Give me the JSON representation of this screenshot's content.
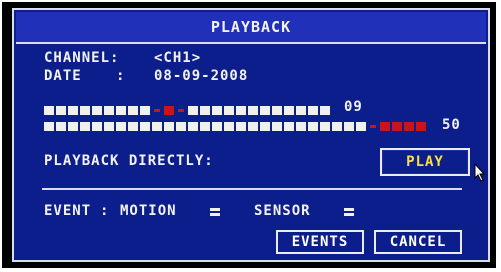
{
  "dialog": {
    "title": "PLAYBACK"
  },
  "channel": {
    "label": "CHANNEL:",
    "value": "<CH1>"
  },
  "date": {
    "label": "DATE",
    "separator": ":",
    "value": "08-09-2008"
  },
  "timeline": {
    "hour_value": "09",
    "minute_value": "50"
  },
  "playback_directly": {
    "label": "PLAYBACK DIRECTLY:",
    "button_label": "PLAY"
  },
  "event_filter": {
    "label": "EVENT",
    "separator": ":",
    "motion_label": "MOTION",
    "sensor_label": "SENSOR"
  },
  "buttons": {
    "events_label": "EVENTS",
    "cancel_label": "CANCEL"
  },
  "colors": {
    "dialog_background": "#0c1e8c",
    "title_background": "#2130b8",
    "marker_red": "#c8141a",
    "play_text": "#f5e23a"
  }
}
